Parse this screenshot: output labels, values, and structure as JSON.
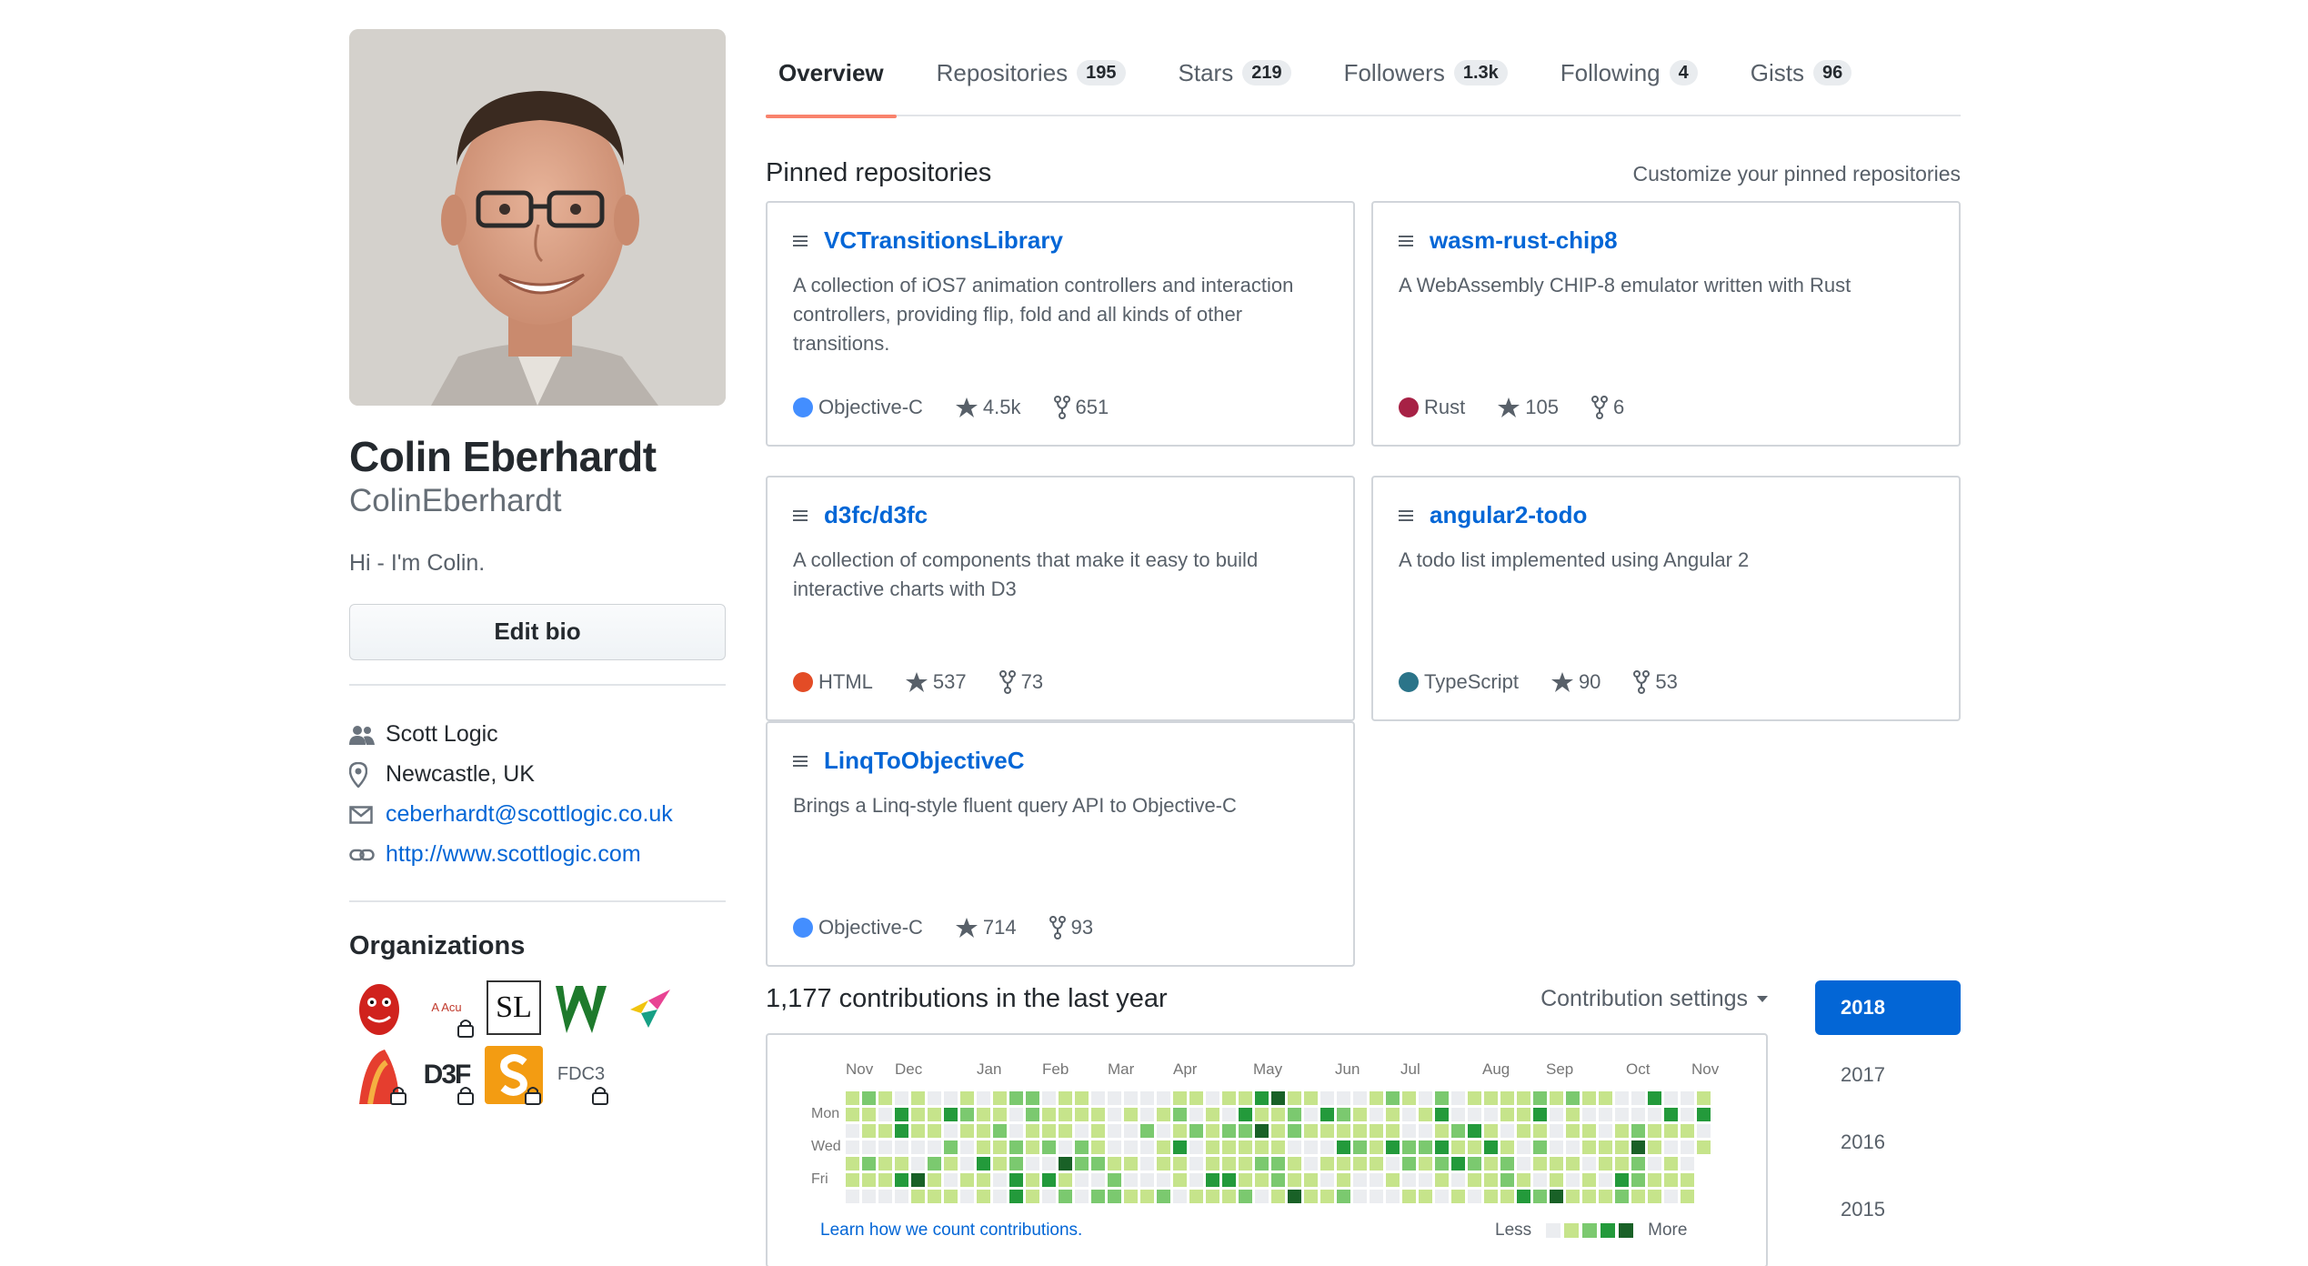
{
  "profile": {
    "full_name": "Colin Eberhardt",
    "username": "ColinEberhardt",
    "bio": "Hi - I'm Colin.",
    "edit_bio_label": "Edit bio",
    "company": "Scott Logic",
    "location": "Newcastle, UK",
    "email": "ceberhardt@scottlogic.co.uk",
    "website": "http://www.scottlogic.com"
  },
  "organizations": {
    "title": "Organizations",
    "items": [
      {
        "label": ""
      },
      {
        "label": "A Acu"
      },
      {
        "label": "SL"
      },
      {
        "label": ""
      },
      {
        "label": ""
      },
      {
        "label": ""
      },
      {
        "label": "D3F"
      },
      {
        "label": ""
      },
      {
        "label": "FDC3"
      }
    ]
  },
  "tabs": [
    {
      "label": "Overview",
      "count": ""
    },
    {
      "label": "Repositories",
      "count": "195"
    },
    {
      "label": "Stars",
      "count": "219"
    },
    {
      "label": "Followers",
      "count": "1.3k"
    },
    {
      "label": "Following",
      "count": "4"
    },
    {
      "label": "Gists",
      "count": "96"
    }
  ],
  "pinned": {
    "title": "Pinned repositories",
    "customize": "Customize your pinned repositories",
    "repos": [
      {
        "name": "VCTransitionsLibrary",
        "desc": "A collection of iOS7 animation controllers and interaction controllers, providing flip, fold and all kinds of other transitions.",
        "lang": "Objective-C",
        "lang_color": "#438eff",
        "stars": "4.5k",
        "forks": "651"
      },
      {
        "name": "wasm-rust-chip8",
        "desc": "A WebAssembly CHIP-8 emulator written with Rust",
        "lang": "Rust",
        "lang_color": "#a72145",
        "stars": "105",
        "forks": "6"
      },
      {
        "name": "d3fc/d3fc",
        "desc": "A collection of components that make it easy to build interactive charts with D3",
        "lang": "HTML",
        "lang_color": "#e34c26",
        "stars": "537",
        "forks": "73"
      },
      {
        "name": "angular2-todo",
        "desc": "A todo list implemented using Angular 2",
        "lang": "TypeScript",
        "lang_color": "#2b7489",
        "stars": "90",
        "forks": "53"
      },
      {
        "name": "LinqToObjectiveC",
        "desc": "Brings a Linq-style fluent query API to Objective-C",
        "lang": "Objective-C",
        "lang_color": "#438eff",
        "stars": "714",
        "forks": "93"
      }
    ]
  },
  "contributions": {
    "title": "1,177 contributions in the last year",
    "settings": "Contribution settings",
    "months": [
      "Nov",
      "Dec",
      "Jan",
      "Feb",
      "Mar",
      "Apr",
      "May",
      "Jun",
      "Jul",
      "Aug",
      "Sep",
      "Oct",
      "Nov"
    ],
    "days": [
      "Mon",
      "Wed",
      "Fri"
    ],
    "learn": "Learn how we count contributions.",
    "less": "Less",
    "more": "More",
    "colors": [
      "#ebedf0",
      "#c6e48b",
      "#7bc96f",
      "#239a3b",
      "#196127"
    ]
  },
  "years": [
    "2018",
    "2017",
    "2016",
    "2015"
  ]
}
